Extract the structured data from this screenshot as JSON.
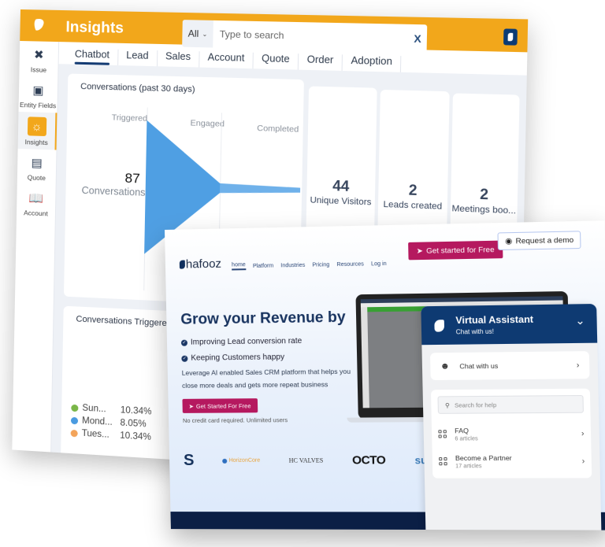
{
  "crm": {
    "app_title": "Insights",
    "search": {
      "scope": "All",
      "placeholder": "Type to search",
      "clear_label": "X"
    },
    "tabs": [
      {
        "label": "Chatbot",
        "active": true
      },
      {
        "label": "Lead"
      },
      {
        "label": "Sales"
      },
      {
        "label": "Account"
      },
      {
        "label": "Quote"
      },
      {
        "label": "Order"
      },
      {
        "label": "Adoption"
      }
    ],
    "sidebar": [
      {
        "label": "Issue",
        "icon": "tools-icon"
      },
      {
        "label": "Entity Fields",
        "icon": "entity-fields-icon"
      },
      {
        "label": "Insights",
        "icon": "lightbulb-icon",
        "active": true
      },
      {
        "label": "Quote",
        "icon": "quote-document-icon"
      },
      {
        "label": "Account",
        "icon": "account-book-icon"
      }
    ],
    "conversations_card": {
      "title": "Conversations (past 30 days)",
      "stages": [
        "Triggered",
        "Engaged",
        "Completed"
      ],
      "total": "87",
      "total_label": "Conversations"
    },
    "stats": [
      {
        "value": "44",
        "label": "Unique Visitors"
      },
      {
        "value": "2",
        "label": "Leads created"
      },
      {
        "value": "2",
        "label": "Meetings boo..."
      }
    ],
    "triggered_card": {
      "title": "Conversations Triggered (",
      "legend": [
        {
          "label": "Sun...",
          "pct": "10.34%",
          "color": "#7ab648"
        },
        {
          "label": "Mond...",
          "pct": "8.05%",
          "color": "#4a9be0"
        },
        {
          "label": "Tues...",
          "pct": "10.34%",
          "color": "#f3a45a"
        }
      ]
    },
    "colors": {
      "brand": "#f2a71b",
      "funnel": "#4f9fe3",
      "nav": "#143b73"
    }
  },
  "site": {
    "brand": "hafooz",
    "nav": [
      {
        "label": "home",
        "active": true
      },
      {
        "label": "Platform"
      },
      {
        "label": "Industries"
      },
      {
        "label": "Pricing"
      },
      {
        "label": "Resources"
      },
      {
        "label": "Log in"
      }
    ],
    "cta_primary": "Get started for Free",
    "cta_secondary": "Request a demo",
    "hero_title": "Grow your Revenue by",
    "bullets": [
      "Improving Lead conversion rate",
      "Keeping Customers happy"
    ],
    "description": "Leverage AI enabled Sales CRM platform that helps you close more deals and gets more repeat business",
    "hero_cta": "Get Started For Free",
    "hero_note": "No credit card required. Unlimited users",
    "logos": [
      "S",
      "HorizonCore",
      "HC VALVES",
      "OCTO",
      "sun"
    ],
    "colors": {
      "cta": "#b5195f",
      "navy": "#0e3a72",
      "footer": "#0b1f45"
    }
  },
  "assistant": {
    "title": "Virtual Assistant",
    "subtitle": "Chat with us!",
    "chat_label": "Chat with us",
    "search_placeholder": "Search for help",
    "articles": [
      {
        "title": "FAQ",
        "count": "6 articles"
      },
      {
        "title": "Become a Partner",
        "count": "17 articles"
      }
    ]
  }
}
